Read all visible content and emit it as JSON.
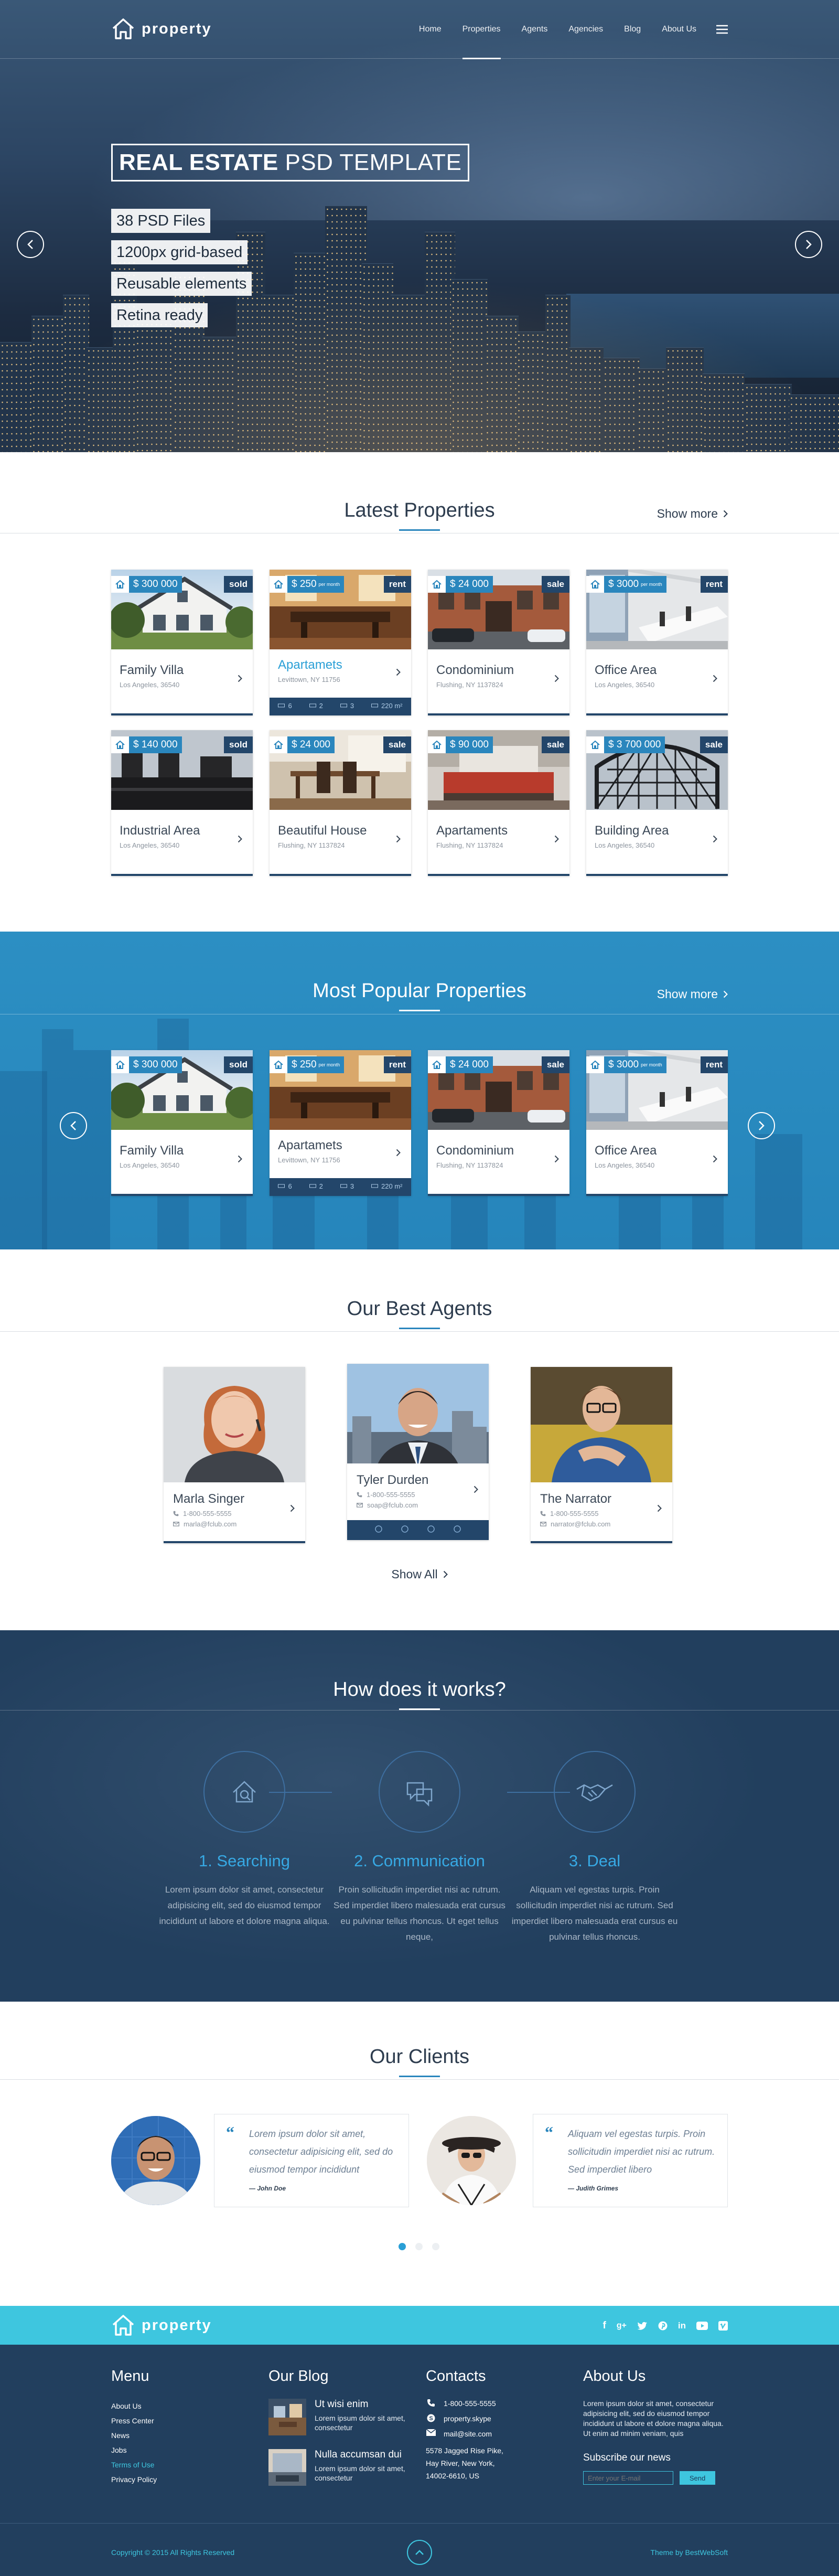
{
  "brand": {
    "name": "property"
  },
  "nav": {
    "items": [
      "Home",
      "Properties",
      "Agents",
      "Agencies",
      "Blog",
      "About Us"
    ],
    "active": "Properties"
  },
  "hero": {
    "title_bold": "REAL ESTATE",
    "title_light": "PSD TEMPLATE",
    "features": [
      "38 PSD Files",
      "1200px grid-based",
      "Reusable elements",
      "Retina ready"
    ]
  },
  "latest": {
    "title": "Latest Properties",
    "show_more": "Show more",
    "cards": [
      {
        "price": "$ 300 000",
        "per": "",
        "tag": "sold",
        "name": "Family Villa",
        "address": "Los Angeles, 36540",
        "photo": "house",
        "highlight": false
      },
      {
        "price": "$ 250",
        "per": "per month",
        "tag": "rent",
        "name": "Apartamets",
        "address": "Levittown, NY 11756",
        "photo": "interior",
        "highlight": true,
        "stats": [
          "6",
          "2",
          "3",
          "220 m²"
        ]
      },
      {
        "price": "$ 24 000",
        "per": "",
        "tag": "sale",
        "name": "Condominium",
        "address": "Flushing, NY 1137824",
        "photo": "brick",
        "highlight": false
      },
      {
        "price": "$ 3000",
        "per": "per month",
        "tag": "rent",
        "name": "Office Area",
        "address": "Los Angeles, 36540",
        "photo": "office",
        "highlight": false
      },
      {
        "price": "$ 140 000",
        "per": "",
        "tag": "sold",
        "name": "Industrial Area",
        "address": "Los Angeles, 36540",
        "photo": "industrial",
        "highlight": false
      },
      {
        "price": "$ 24 000",
        "per": "",
        "tag": "sale",
        "name": "Beautiful House",
        "address": "Flushing, NY 1137824",
        "photo": "dining",
        "highlight": false
      },
      {
        "price": "$ 90 000",
        "per": "",
        "tag": "sale",
        "name": "Apartaments",
        "address": "Flushing, NY 1137824",
        "photo": "bedroom",
        "highlight": false
      },
      {
        "price": "$ 3 700 000",
        "per": "",
        "tag": "sale",
        "name": "Building Area",
        "address": "Los Angeles, 36540",
        "photo": "frame",
        "highlight": false
      }
    ]
  },
  "popular": {
    "title": "Most Popular Properties",
    "show_more": "Show more",
    "cards": [
      {
        "price": "$ 300 000",
        "per": "",
        "tag": "sold",
        "name": "Family Villa",
        "address": "Los Angeles, 36540",
        "photo": "house",
        "highlight": false
      },
      {
        "price": "$ 250",
        "per": "per month",
        "tag": "rent",
        "name": "Apartamets",
        "address": "Levittown, NY 11756",
        "photo": "interior",
        "highlight": false,
        "stats": [
          "6",
          "2",
          "3",
          "220 m²"
        ]
      },
      {
        "price": "$ 24 000",
        "per": "",
        "tag": "sale",
        "name": "Condominium",
        "address": "Flushing, NY 1137824",
        "photo": "brick",
        "highlight": false
      },
      {
        "price": "$ 3000",
        "per": "per month",
        "tag": "rent",
        "name": "Office Area",
        "address": "Los Angeles, 36540",
        "photo": "office",
        "highlight": false
      }
    ]
  },
  "agents": {
    "title": "Our Best Agents",
    "show_all": "Show All",
    "list": [
      {
        "name": "Marla Singer",
        "phone": "1-800-555-5555",
        "email": "marla@fclub.com",
        "photo": "woman"
      },
      {
        "name": "Tyler Durden",
        "phone": "1-800-555-5555",
        "email": "soap@fclub.com",
        "photo": "man-city",
        "social": true
      },
      {
        "name": "The Narrator",
        "phone": "1-800-555-5555",
        "email": "narrator@fclub.com",
        "photo": "man-glasses"
      }
    ]
  },
  "how": {
    "title": "How does it works?",
    "steps": [
      {
        "title": "1. Searching",
        "text": "Lorem ipsum dolor sit amet, consectetur adipisicing elit, sed do eiusmod tempor incididunt ut labore et dolore magna aliqua.",
        "icon": "home-search-icon"
      },
      {
        "title": "2. Communication",
        "text": "Proin sollicitudin imperdiet nisi ac rutrum. Sed imperdiet libero malesuada erat cursus eu pulvinar tellus rhoncus. Ut eget tellus neque,",
        "icon": "chat-bubbles-icon"
      },
      {
        "title": "3. Deal",
        "text": "Aliquam vel egestas turpis. Proin sollicitudin imperdiet nisi ac rutrum. Sed imperdiet libero malesuada erat cursus eu pulvinar tellus rhoncus.",
        "icon": "handshake-icon"
      }
    ]
  },
  "clients": {
    "title": "Our Clients",
    "testimonials": [
      {
        "text": "Lorem ipsum dolor sit amet, consectetur adipisicing elit, sed do eiusmod tempor incididunt",
        "author": "— John Doe"
      },
      {
        "text": "Aliquam vel egestas turpis. Proin sollicitudin imperdiet nisi ac rutrum. Sed imperdiet libero",
        "author": "— Judith Grimes"
      }
    ]
  },
  "footer": {
    "menu_title": "Menu",
    "menu": [
      "About Us",
      "Press Center",
      "News",
      "Jobs",
      "Terms of Use",
      "Privacy Policy"
    ],
    "menu_highlight": "Terms of Use",
    "blog_title": "Our Blog",
    "blog": [
      {
        "title": "Ut wisi enim",
        "text": "Lorem ipsum dolor sit amet, consectetur"
      },
      {
        "title": "Nulla accumsan dui",
        "text": "Lorem ipsum dolor sit amet, consectetur"
      }
    ],
    "contacts_title": "Contacts",
    "contacts": {
      "phone": "1-800-555-5555",
      "skype": "property.skype",
      "email": "mail@site.com",
      "address": "5578 Jagged Rise Pike, Hay River, New York, 14002-6610, US"
    },
    "about_title": "About Us",
    "about_text": "Lorem ipsum dolor sit amet, consectetur adipisicing elit, sed do eiusmod tempor incididunt ut labore et dolore magna aliqua. Ut enim ad minim veniam, quis",
    "subscribe_title": "Subscribe our news",
    "subscribe_placeholder": "Enter your E-mail",
    "subscribe_button": "Send",
    "copyright": "Copyright © 2015 All Rights Reserved",
    "credit": "Theme by BestWebSoft"
  },
  "colors": {
    "primary": "#2a86bd",
    "dark": "#223f5e",
    "cyan": "#3ec6df"
  }
}
